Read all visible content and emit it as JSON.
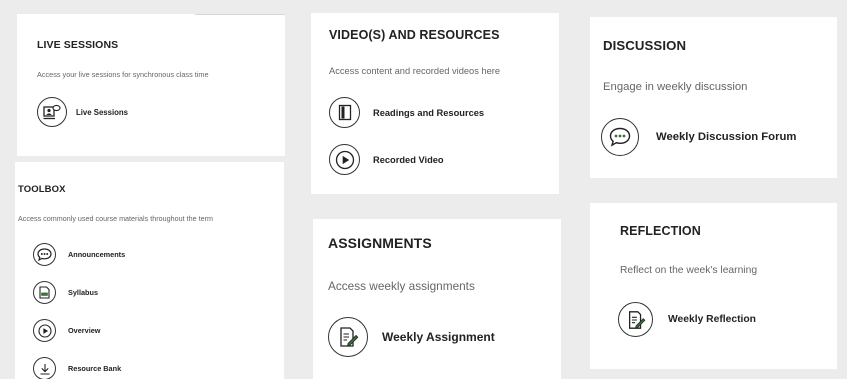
{
  "live_sessions": {
    "title": "LIVE SESSIONS",
    "description": "Access your live sessions for synchronous class time",
    "links": [
      {
        "label": "Live Sessions",
        "icon": "live-session-icon"
      }
    ]
  },
  "toolbox": {
    "title": "TOOLBOX",
    "description": "Access commonly used course materials throughout the term",
    "links": [
      {
        "label": "Announcements",
        "icon": "chat-bubble-icon"
      },
      {
        "label": "Syllabus",
        "icon": "syllabus-icon"
      },
      {
        "label": "Overview",
        "icon": "play-icon"
      },
      {
        "label": "Resource Bank",
        "icon": "download-icon"
      }
    ]
  },
  "videos": {
    "title": "VIDEO(S) AND RESOURCES",
    "description": "Access content and recorded videos here",
    "links": [
      {
        "label": "Readings and Resources",
        "icon": "book-icon"
      },
      {
        "label": "Recorded Video",
        "icon": "play-icon"
      }
    ]
  },
  "assignments": {
    "title": "ASSIGNMENTS",
    "description": "Access weekly assignments",
    "links": [
      {
        "label": "Weekly Assignment",
        "icon": "edit-document-icon"
      }
    ]
  },
  "discussion": {
    "title": "DISCUSSION",
    "description": "Engage in weekly discussion",
    "links": [
      {
        "label": "Weekly Discussion Forum",
        "icon": "chat-bubble-icon"
      }
    ]
  },
  "reflection": {
    "title": "REFLECTION",
    "description": "Reflect on the week's learning",
    "links": [
      {
        "label": "Weekly Reflection",
        "icon": "edit-document-icon"
      }
    ]
  }
}
